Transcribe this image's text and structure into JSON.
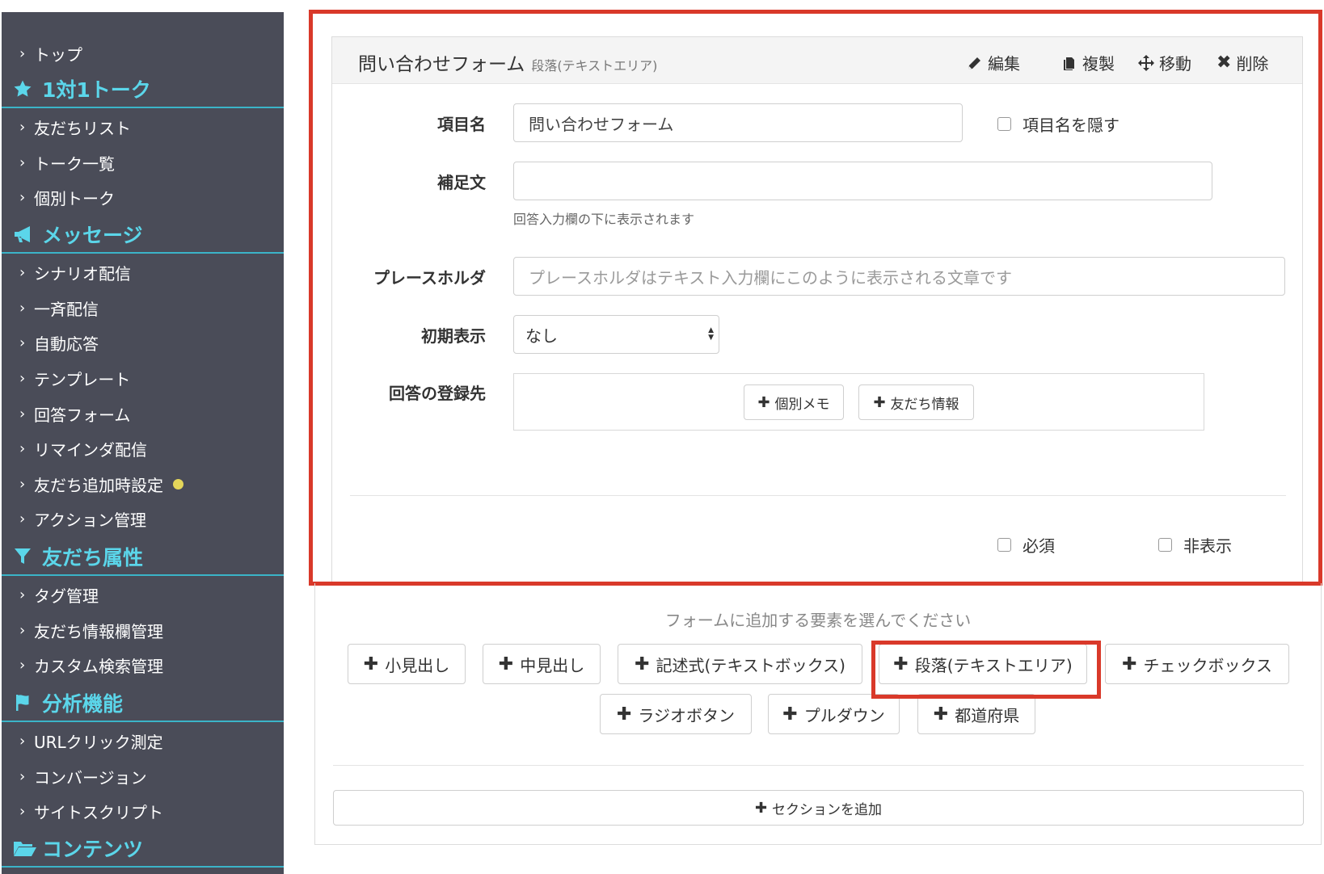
{
  "sidebar": {
    "top_item": "トップ",
    "sections": [
      {
        "title": "1対1トーク",
        "icon": "star-icon",
        "items": [
          "友だちリスト",
          "トーク一覧",
          "個別トーク"
        ]
      },
      {
        "title": "メッセージ",
        "icon": "megaphone-icon",
        "items": [
          "シナリオ配信",
          "一斉配信",
          "自動応答",
          "テンプレート",
          "回答フォーム",
          "リマインダ配信",
          "友だち追加時設定",
          "アクション管理"
        ]
      },
      {
        "title": "友だち属性",
        "icon": "filter-icon",
        "items": [
          "タグ管理",
          "友だち情報欄管理",
          "カスタム検索管理"
        ]
      },
      {
        "title": "分析機能",
        "icon": "flag-icon",
        "items": [
          "URLクリック測定",
          "コンバージョン",
          "サイトスクリプト"
        ]
      },
      {
        "title": "コンテンツ",
        "icon": "folder-open-icon",
        "items": []
      }
    ],
    "badge_color": "#e4d65a",
    "accent": "#5bd6ea"
  },
  "panel": {
    "title": "問い合わせフォーム",
    "subtitle": "段落(テキストエリア)",
    "actions": {
      "edit": "編集",
      "copy": "複製",
      "move": "移動",
      "delete": "削除"
    },
    "fields": {
      "item_name_label": "項目名",
      "item_name_value": "問い合わせフォーム",
      "hide_label": "項目名を隠す",
      "supplement_label": "補足文",
      "supplement_value": "",
      "supplement_help": "回答入力欄の下に表示されます",
      "placeholder_label": "プレースホルダ",
      "placeholder_value": "プレースホルダはテキスト入力欄にこのように表示される文章です",
      "initial_label": "初期表示",
      "initial_value": "なし",
      "dest_label": "回答の登録先",
      "dest_memo": "個別メモ",
      "dest_friend": "友だち情報",
      "required_label": "必須",
      "hidden_label": "非表示"
    }
  },
  "lower": {
    "prompt": "フォームに追加する要素を選んでください",
    "buttons_row1": [
      "小見出し",
      "中見出し",
      "記述式(テキストボックス)",
      "段落(テキストエリア)",
      "チェックボックス"
    ],
    "buttons_row2": [
      "ラジオボタン",
      "プルダウン",
      "都道府県"
    ],
    "add_section": "セクションを追加"
  },
  "colors": {
    "highlight": "#d9392a",
    "sidebar_bg": "#4a4c58"
  }
}
